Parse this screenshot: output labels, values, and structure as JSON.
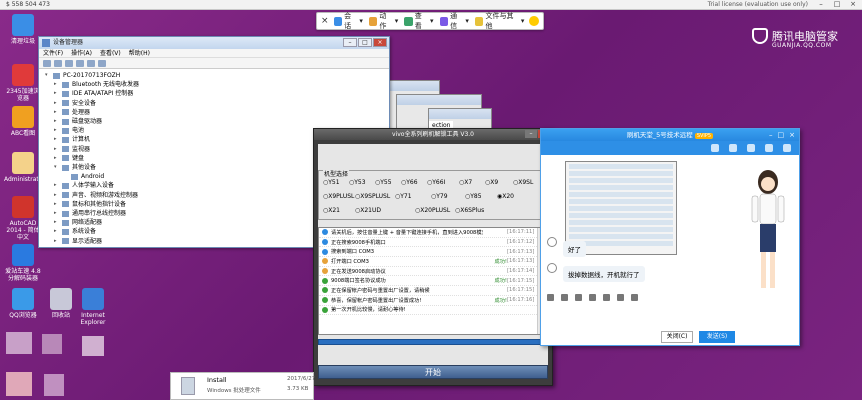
{
  "remote_bar": {
    "address": "$ 558 504 473",
    "license": "Trial license (evaluation use only)",
    "minimize": "–",
    "maximize": "□",
    "close": "×"
  },
  "toolbar": {
    "close": "×",
    "items": [
      {
        "label": "会话",
        "icon": "session-icon",
        "color": "#3a8ee6"
      },
      {
        "label": "动作",
        "icon": "action-icon",
        "color": "#e6a23a"
      },
      {
        "label": "查看",
        "icon": "view-icon",
        "color": "#3aa36a"
      },
      {
        "label": "通信",
        "icon": "communication-icon",
        "color": "#7a5ae6"
      },
      {
        "label": "文件与其他",
        "icon": "file-icon",
        "color": "#e6c23a"
      }
    ]
  },
  "brand": {
    "name": "腾讯电脑管家",
    "domain": "GUANJIA.QQ.COM"
  },
  "desktop_icons": [
    {
      "label": "清理垃圾",
      "color": "#3a8ee6"
    },
    {
      "label": "2345加速浏览器",
      "color": "#e03a3a"
    },
    {
      "label": "ABC看图",
      "color": "#f0a020"
    },
    {
      "label": "Administrator",
      "color": "#f4d28a"
    },
    {
      "label": "AutoCAD 2014 - 简体中文",
      "color": "#d0342c"
    },
    {
      "label": "爱站车速 4.8 分解码装器",
      "color": "#2a7ae0"
    },
    {
      "label": "QQ浏览器",
      "color": "#3a9ae8"
    },
    {
      "label": "回收站",
      "color": "#c8c8d8"
    },
    {
      "label": "Internet Explorer",
      "color": "#3a7fd8"
    }
  ],
  "devmgr": {
    "title": "设备管理器",
    "menu": [
      "文件(F)",
      "操作(A)",
      "查看(V)",
      "帮助(H)"
    ],
    "tree": [
      {
        "label": "PC-20170713FOZH",
        "level": 0,
        "toggle": "▾"
      },
      {
        "label": "Bluetooth 无线电收发器",
        "level": 1,
        "toggle": "▸"
      },
      {
        "label": "IDE ATA/ATAPI 控制器",
        "level": 1,
        "toggle": "▸"
      },
      {
        "label": "安全设备",
        "level": 1,
        "toggle": "▸"
      },
      {
        "label": "处理器",
        "level": 1,
        "toggle": "▸"
      },
      {
        "label": "磁盘驱动器",
        "level": 1,
        "toggle": "▸"
      },
      {
        "label": "电池",
        "level": 1,
        "toggle": "▸"
      },
      {
        "label": "计算机",
        "level": 1,
        "toggle": "▸"
      },
      {
        "label": "监视器",
        "level": 1,
        "toggle": "▸"
      },
      {
        "label": "键盘",
        "level": 1,
        "toggle": "▸"
      },
      {
        "label": "其他设备",
        "level": 1,
        "toggle": "▾"
      },
      {
        "label": "Android",
        "level": 2,
        "toggle": ""
      },
      {
        "label": "人体学输入设备",
        "level": 1,
        "toggle": "▸"
      },
      {
        "label": "声音、视频和游戏控制器",
        "level": 1,
        "toggle": "▸"
      },
      {
        "label": "鼠标和其他指针设备",
        "level": 1,
        "toggle": "▸"
      },
      {
        "label": "通用串行总线控制器",
        "level": 1,
        "toggle": "▸"
      },
      {
        "label": "网络适配器",
        "level": 1,
        "toggle": "▸"
      },
      {
        "label": "系统设备",
        "level": 1,
        "toggle": "▸"
      },
      {
        "label": "显示适配器",
        "level": 1,
        "toggle": "▸"
      }
    ]
  },
  "bg_window": {
    "tab": "ection"
  },
  "vivo": {
    "title": "vivo全系列刷机解锁工具 V3.0",
    "models_label": "机型选择",
    "models": [
      [
        "Y51",
        "Y53",
        "Y55",
        "Y66",
        "Y66I",
        "X7",
        "X9",
        "X9SL"
      ],
      [
        "X9PLUSL",
        "X9SPLUSL",
        "Y71",
        "Y79",
        "Y85",
        "X20"
      ],
      [
        "X21",
        "X21UD",
        "X20PLUSL",
        "X6SPlus"
      ]
    ],
    "selected_model": "X20",
    "logs": [
      {
        "msg": "请关机后，按住音量上键 + 音量下键连接手机，直到进入9008模式",
        "status": "",
        "time": "[16:17:11]",
        "color": "#2d8ae0"
      },
      {
        "msg": "正在搜索9008手机端口",
        "status": "",
        "time": "[16:17:12]",
        "color": "#2d8ae0"
      },
      {
        "msg": "搜索到端口 COM3",
        "status": "",
        "time": "[16:17:13]",
        "color": "#2d8ae0"
      },
      {
        "msg": "打开端口 COM3",
        "status": "成功!",
        "time": "[16:17:13]",
        "color": "#e6a23a"
      },
      {
        "msg": "正在发送9008启动协议",
        "status": "",
        "time": "[16:17:14]",
        "color": "#e6a23a"
      },
      {
        "msg": "9008端口签名协议成功",
        "status": "成功!",
        "time": "[16:17:15]",
        "color": "#3aa33a"
      },
      {
        "msg": "正在保留帐户密码与重置出厂设置，请稍候",
        "status": "",
        "time": "[16:17:15]",
        "color": "#3aa33a"
      },
      {
        "msg": "恭喜，保留帐户密码重置出厂设置成功!",
        "status": "成功!",
        "time": "[16:17:16]",
        "color": "#3aa33a"
      },
      {
        "msg": "第一次开机比较慢，请耐心等待!",
        "status": "",
        "time": "",
        "color": "#3aa33a"
      }
    ],
    "progress": 1,
    "start_label": "开始"
  },
  "qq": {
    "title": "刷机天堂_5号技术远程",
    "badge": "SVIP5",
    "messages": [
      {
        "text": "好了"
      },
      {
        "text": "拔掉数据线，开机就行了"
      }
    ],
    "close_label": "关闭(C)",
    "send_label": "发送(S)"
  },
  "filepanel": {
    "name": "Install",
    "type": "Windows 批处理文件",
    "date": "2017/6/27",
    "size": "3.73 KB"
  }
}
